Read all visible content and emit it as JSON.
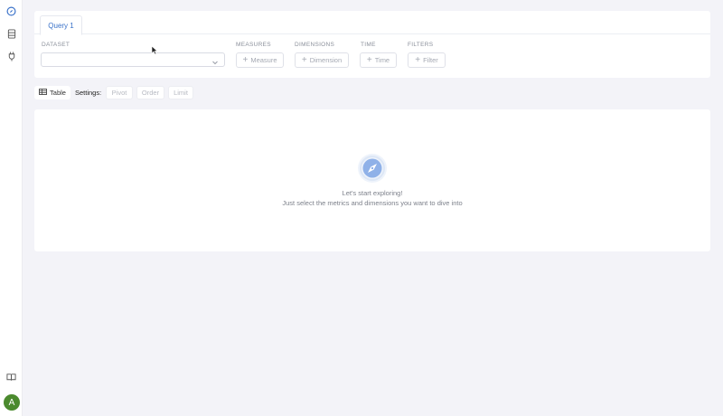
{
  "sidebar": {
    "items": [
      {
        "icon": "compass-icon"
      },
      {
        "icon": "database-icon"
      },
      {
        "icon": "plug-icon"
      }
    ],
    "bottom": {
      "icon": "book-icon"
    },
    "avatar": {
      "initial": "A",
      "color": "#4b8a2e"
    }
  },
  "tabs": [
    {
      "label": "Query 1",
      "active": true
    }
  ],
  "query": {
    "dataset": {
      "label": "DATASET",
      "value": ""
    },
    "measures": {
      "label": "MEASURES",
      "button": "Measure"
    },
    "dimensions": {
      "label": "DIMENSIONS",
      "button": "Dimension"
    },
    "time": {
      "label": "TIME",
      "button": "Time"
    },
    "filters": {
      "label": "FILTERS",
      "button": "Filter"
    }
  },
  "toolbar": {
    "view": "Table",
    "settings_label": "Settings:",
    "settings": [
      "Pivot",
      "Order",
      "Limit"
    ]
  },
  "empty_state": {
    "title": "Let's start exploring!",
    "subtitle": "Just select the metrics and dimensions you want to dive into"
  },
  "colors": {
    "accent": "#3a72c9",
    "background": "#f3f3f8",
    "panel": "#ffffff"
  }
}
